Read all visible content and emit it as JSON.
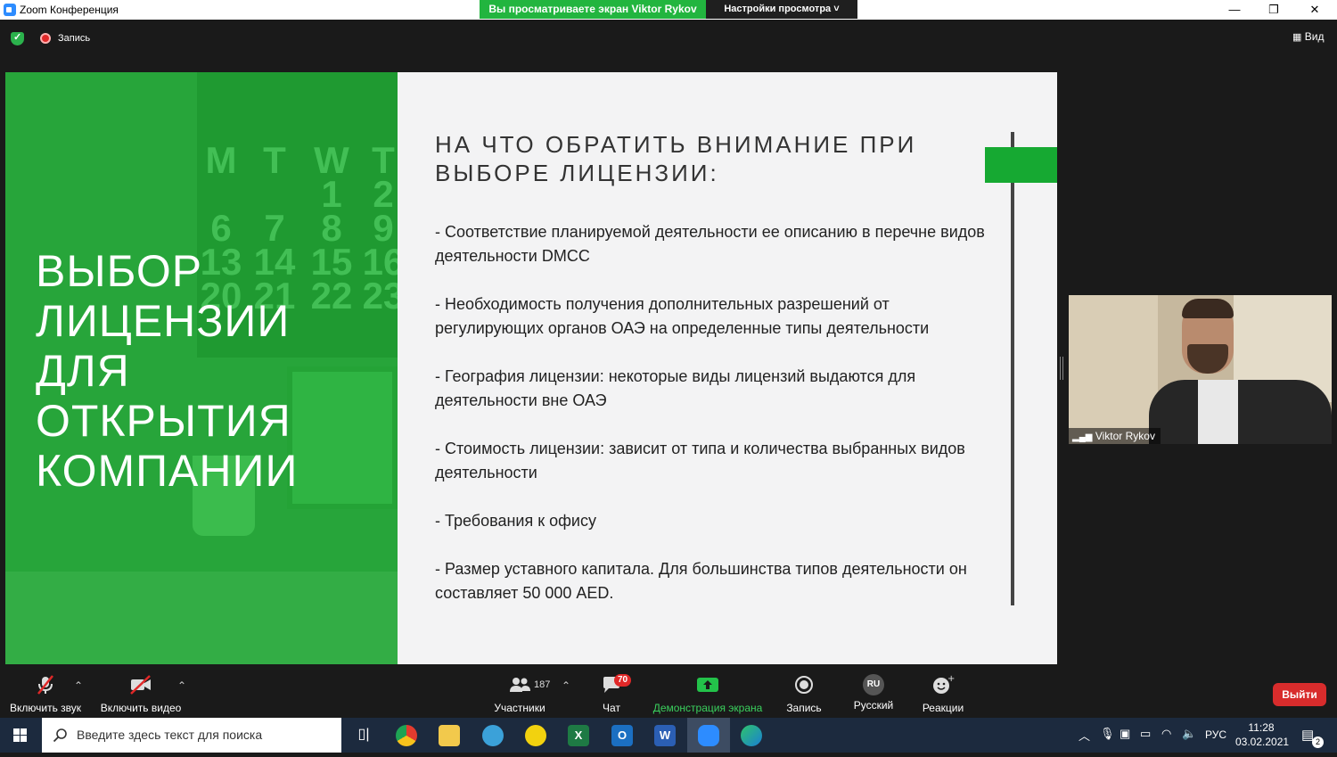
{
  "window": {
    "title": "Zoom Конференция",
    "viewing_banner": "Вы просматриваете экран Viktor Rykov",
    "view_options": "Настройки просмотра ˅",
    "controls": [
      "—",
      "❐",
      "✕"
    ]
  },
  "meeting_bar": {
    "recording_label": "Запись",
    "view_label": "Вид"
  },
  "slide": {
    "heading": [
      "ВЫБОР",
      "ЛИЦЕНЗИИ",
      "ДЛЯ",
      "ОТКРЫТИЯ",
      "КОМПАНИИ"
    ],
    "calendar_columns": [
      {
        "letter": "M",
        "nums": [
          "",
          "6",
          "13",
          "20"
        ]
      },
      {
        "letter": "T",
        "nums": [
          "",
          "7",
          "14",
          "21"
        ]
      },
      {
        "letter": "W",
        "nums": [
          "1",
          "8",
          "15",
          "22"
        ]
      },
      {
        "letter": "T",
        "nums": [
          "2",
          "9",
          "16",
          "23"
        ]
      }
    ],
    "title_line1": "НА ЧТО ОБРАТИТЬ ВНИМАНИЕ ПРИ",
    "title_line2": "ВЫБОРЕ ЛИЦЕНЗИИ:",
    "bullets": [
      "- Соответствие планируемой деятельности ее описанию в перечне видов деятельности DMCC",
      "- Необходимость получения дополнительных разрешений от регулирующих органов ОАЭ  на определенные типы деятельности",
      "- География лицензии: некоторые виды лицензий выдаются для деятельности вне ОАЭ",
      "- Стоимость лицензии: зависит от типа и количества выбранных видов деятельности",
      "- Требования к офису",
      "- Размер уставного капитала. Для большинства типов деятельности он составляет 50 000 AED."
    ]
  },
  "participant": {
    "name": "Viktor Rykov"
  },
  "toolbar": {
    "audio": "Включить звук",
    "video": "Включить видео",
    "participants_count": "187",
    "participants": "Участники",
    "chat": "Чат",
    "chat_badge": "70",
    "share": "Демонстрация экрана",
    "record": "Запись",
    "language_code": "RU",
    "language": "Русский",
    "reactions": "Реакции",
    "leave": "Выйти"
  },
  "taskbar": {
    "search_placeholder": "Введите здесь текст для поиска",
    "lang": "РУС",
    "time": "11:28",
    "date": "03.02.2021",
    "notifications": "2"
  },
  "colors": {
    "slide_green": "#27a53a",
    "banner_green": "#22b53f",
    "leave_red": "#d82c2c"
  }
}
